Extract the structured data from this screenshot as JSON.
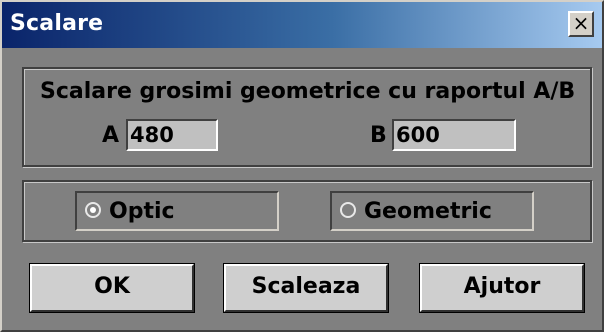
{
  "window": {
    "title": "Scalare",
    "close_glyph": "×",
    "close_icon": "close-icon"
  },
  "scale_group": {
    "title": "Scalare grosimi geometrice cu raportul A/B",
    "a_label": "A",
    "a_value": "480",
    "b_label": "B",
    "b_value": "600"
  },
  "mode": {
    "options": [
      {
        "label": "Optic",
        "selected": true
      },
      {
        "label": "Geometric",
        "selected": false
      }
    ]
  },
  "buttons": {
    "ok": "OK",
    "scale": "Scaleaza",
    "help": "Ajutor"
  },
  "colors": {
    "title_gradient_start": "#0a246a",
    "title_gradient_end": "#a6caf0",
    "dialog_background": "#808080",
    "button_face": "#cfcfcf"
  }
}
